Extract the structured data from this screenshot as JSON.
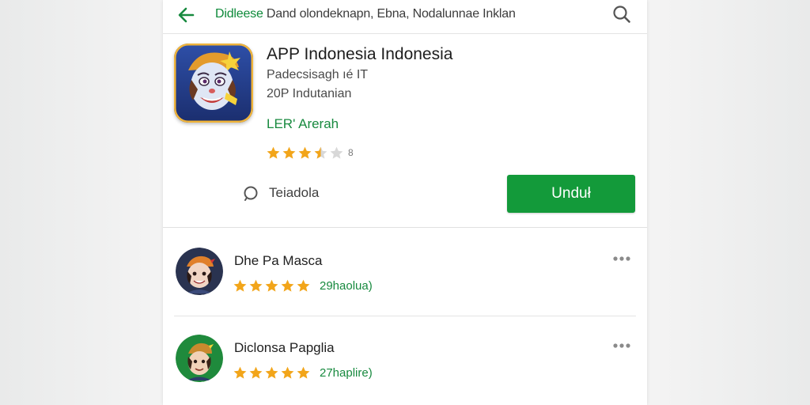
{
  "topbar": {
    "breadcrumb_prefix": "Didleese",
    "breadcrumb_rest": " Dand olondeknapn, Ebna, Nodalunnae Inklan"
  },
  "app": {
    "title": "APP Indonesia Indonesia",
    "subtitle1": "Padecsisagh ıé IT",
    "subtitle2": "20P Indutanian",
    "developer": "LER' Arerah",
    "rating": 3.5,
    "rating_count": "8",
    "wishlist_label": "Teiadola",
    "install_label": "Unduł"
  },
  "reviews": [
    {
      "name": "Dhe Pa Masca",
      "stars": 5,
      "count": "29haolua)"
    },
    {
      "name": "Diclonsa Papglia",
      "stars": 5,
      "count": "27haplire)"
    }
  ],
  "colors": {
    "accent_green": "#139a3a",
    "link_green": "#188a3f",
    "star_gold": "#f2a51a",
    "star_empty": "#d8d8d8"
  },
  "icons": {
    "back": "arrow-left-icon",
    "search": "search-icon",
    "wishlist": "circle-outline-icon",
    "more": "more-dots-icon"
  }
}
